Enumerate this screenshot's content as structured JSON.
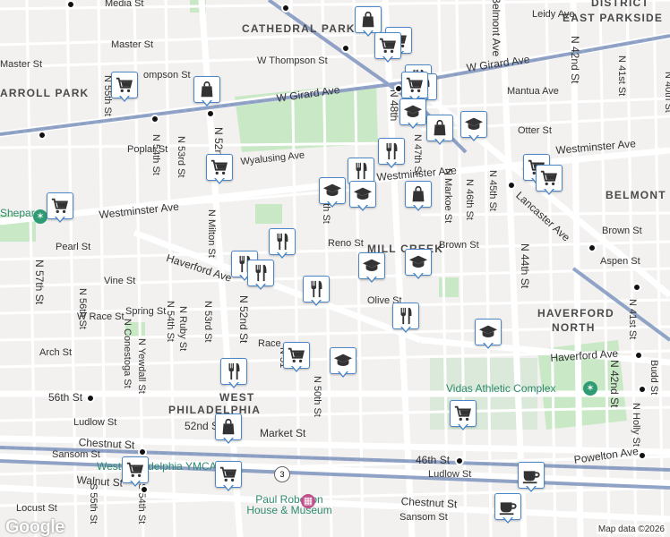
{
  "map": {
    "attribution": "Map data ©2026",
    "logo": "Google",
    "route_shield": "3",
    "neighborhoods": [
      "CATHEDRAL PARK",
      "EAST PARKSIDE",
      "BELMONT",
      "MILL CREEK",
      "HAVERFORD",
      "NORTH",
      "DISTRICT",
      "WEST",
      "PHILADELPHIA",
      "ARROLL PARK"
    ],
    "streets": {
      "media": "Media St",
      "master": "Master St",
      "w_thompson": "W Thompson St",
      "thompson": "ompson St",
      "w_girard_1": "W Girard Ave",
      "w_girard_2": "W Girard Ave",
      "w_girard_3": "Girard Ave",
      "poplar": "Poplar St",
      "wyalusing": "Wyalusing Ave",
      "westminster_1": "Westminster Ave",
      "westminster_2": "Westminster Ave",
      "westminster_3": "Westminster Ave",
      "pearl": "Pearl St",
      "reno": "Reno St",
      "brown_1": "Brown St",
      "brown_2": "Brown St",
      "aspen": "Aspen St",
      "haverford_1": "Haverford Ave",
      "haverford_2": "Haverford Ave",
      "vine": "Vine St",
      "spring": "Spring St",
      "w_race": "W Race St",
      "race": "Race",
      "arch": "Arch St",
      "s56": "56th St",
      "ludlow_1": "Ludlow St",
      "ludlow_2": "Ludlow St",
      "s52": "52nd St",
      "market": "Market St",
      "chestnut_1": "Chestnut St",
      "chestnut_2": "Chestnut St",
      "sansom_1": "Sansom St",
      "sansom_2": "Sansom St",
      "walnut": "Walnut St",
      "locust": "Locust St",
      "s46": "46th St",
      "powelton": "Powelton Ave",
      "olive": "Olive St",
      "aspen2": "Aspen St",
      "otter": "Otter St",
      "mantua": "Mantua Ave",
      "leidy": "Leidy Ave",
      "n57": "N 57th St",
      "n56": "N 56th St",
      "n55": "N 55th St",
      "n54": "N 54th St",
      "n53": "N 53rd St",
      "n52": "N 52nd St",
      "n52b": "N 52nd St",
      "milton": "N Milton St",
      "ruby": "N Ruby St",
      "yewdall": "N Yewdall St",
      "conestoga": "N Conestoga St",
      "n54b": "N 54th St",
      "n53b": "N 53rd St",
      "n51": "N 51",
      "n50": "N 50th St",
      "n60": "60th St",
      "n48": "N 48th",
      "n47": "N 47th St",
      "markoe": "N Markoe St",
      "n46": "N 46th St",
      "n45": "N 45th St",
      "n44": "N 44th St",
      "n43": "N 42nd St",
      "n41": "N 41st St",
      "n40": "N 40th St",
      "belmont": "Belmont Ave",
      "n42b": "N 42nd St",
      "n41b": "N 41st St",
      "holly": "N Holly St",
      "budd": "Budd St",
      "lancaster": "Lancaster Ave",
      "s55": "S 55th St",
      "s54": "S 54th St",
      "n33": "N 53rd St",
      "aspen_st": "A",
      "n48b": "48th"
    },
    "pois": {
      "vidas": "Vidas Athletic Complex",
      "robeson": "Paul Robeson House & Museum",
      "westphila_ymca": "West Philadelphia YMCA",
      "shepard": "Shepard Recreation Center"
    },
    "poi_icons": [
      "shopping-bag-icon",
      "shopping-cart-icon",
      "restaurant-icon",
      "school-icon",
      "coffee-icon"
    ],
    "colors": {
      "marker_border": "#4a86c8",
      "park": "#c9e8c6",
      "rail": "#6e88b8",
      "poi_text": "#2e8b6f"
    }
  }
}
